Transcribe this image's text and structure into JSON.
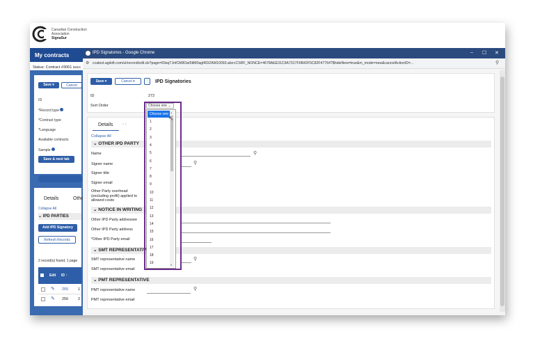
{
  "background_app": {
    "logo_lines": [
      "Canadian Construction",
      "Association",
      "SignaSur"
    ],
    "nav_title": "My contracts",
    "status": "Status: Contract #3061 succ",
    "save": "Save",
    "save_chevron": "▾",
    "cancel": "Cancel",
    "fields": [
      "ID",
      "*Record type",
      "*Contract type",
      "*Language",
      "Available contracts",
      "Sample"
    ],
    "save_next": "Save & next tab",
    "tabs": [
      "Details",
      "Othe"
    ],
    "collapse_all": "Collapse All",
    "section": "IPD PARTIES",
    "add_button": "Add IPD Signatory",
    "refresh_button": "Refresh Records",
    "records_found": "2 record(s) found, 1 page",
    "table_headers": [
      "Edit",
      "ID ↑"
    ],
    "rows": [
      {
        "id": "255",
        "num": "1"
      },
      {
        "id": "256",
        "num": "2"
      }
    ]
  },
  "window": {
    "title": "IPD Signatories - Google Chrome",
    "minimize": "–",
    "maximize": "☐",
    "close": "✕",
    "url": "ccatest.agiloft.com/ui/record/edit.do?page=69sqTJnfCM8OaI5tlM0agtRDZAM10093.aIercCSRF_NONCE=4678AEE31C9A7317F6B42F5C82F47764?$hideNew=true&m_mode=new&cancelActionID=..."
  },
  "form": {
    "save": "Save",
    "save_chevron": "▾",
    "cancel": "Cancel",
    "cancel_chevron": "▾",
    "more": "⋮",
    "title": "IPD Signatories",
    "id_label": "ID",
    "id_value": "272",
    "sort_order_label": "Sort Order",
    "sort_order_value": "Choose one",
    "tab_details": "Details",
    "tab_arrows": "‹ ›",
    "collapse_all": "Collapse All",
    "sections": [
      {
        "title": "OTHER IPD PARTY",
        "fields": [
          "Name",
          "Signer name",
          "Signer title",
          "Signer email",
          "Other Party overhead (excluding profit) applied to allowed costs"
        ]
      },
      {
        "title": "NOTICE IN WRITING",
        "fields": [
          "Other IPD Party addressee",
          "Other IPD Party address",
          "*Other IPD Party email"
        ]
      },
      {
        "title": "SMT REPRESENTATIVE",
        "fields": [
          "SMT representative name",
          "SMT representative email"
        ]
      },
      {
        "title": "PMT REPRESENTATIVE",
        "fields": [
          "PMT representative name",
          "PMT representative email"
        ]
      }
    ]
  },
  "dropdown": {
    "selected": "Choose one",
    "options": [
      "1",
      "2",
      "3",
      "4",
      "5",
      "6",
      "7",
      "8",
      "9",
      "10",
      "11",
      "12",
      "13",
      "14",
      "15",
      "16",
      "17",
      "18",
      "19"
    ]
  },
  "colors": {
    "brand_blue": "#2e5ea8",
    "titlebar": "#2b4a7e",
    "highlight_outline": "#6a2b8c",
    "selected_option": "#1a73e8"
  }
}
